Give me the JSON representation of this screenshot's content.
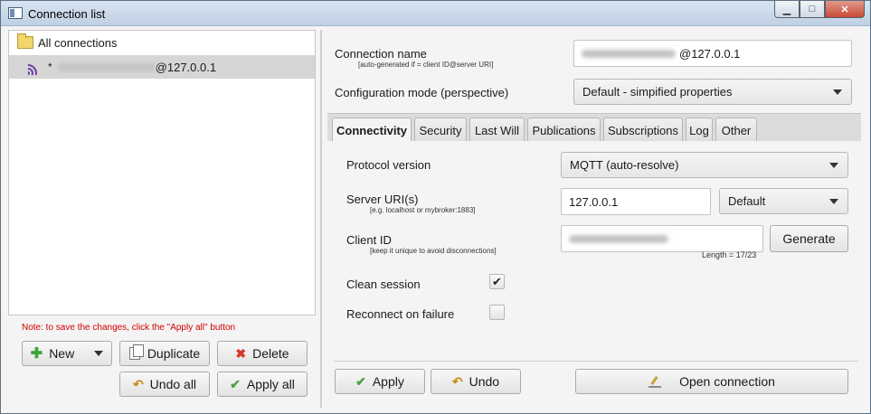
{
  "window": {
    "title": "Connection list",
    "min_label": "▁",
    "max_label": "□",
    "close_label": "✕"
  },
  "tree": {
    "root_label": "All connections",
    "connection_prefix": "*",
    "connection_suffix": "@127.0.0.1"
  },
  "left": {
    "note": "Note: to save the changes, click the \"Apply all\" button",
    "new_label": "New",
    "duplicate_label": "Duplicate",
    "delete_label": "Delete",
    "undo_all_label": "Undo all",
    "apply_all_label": "Apply all"
  },
  "connection": {
    "name_label": "Connection name",
    "name_hint": "[auto-generated if = client ID@server URI]",
    "name_value_suffix": "@127.0.0.1",
    "mode_label": "Configuration mode (perspective)",
    "mode_value": "Default - simpified properties"
  },
  "tabs": [
    "Connectivity",
    "Security",
    "Last Will",
    "Publications",
    "Subscriptions",
    "Log",
    "Other"
  ],
  "connectivity": {
    "protocol_label": "Protocol version",
    "protocol_value": "MQTT (auto-resolve)",
    "server_label": "Server URI(s)",
    "server_hint": "[e.g. localhost or mybroker:1883]",
    "server_value": "127.0.0.1",
    "server_type": "Default",
    "client_label": "Client ID",
    "client_hint": "[keep it unique to avoid disconnections]",
    "generate_label": "Generate",
    "length_text": "Length = 17/23",
    "clean_label": "Clean session",
    "clean_checked": true,
    "reconnect_label": "Reconnect on failure",
    "reconnect_checked": false
  },
  "actions": {
    "apply_label": "Apply",
    "undo_label": "Undo",
    "open_label": "Open connection"
  },
  "icons": {
    "check": "✔",
    "undo": "↶",
    "plus": "✚",
    "delete": "✖"
  }
}
